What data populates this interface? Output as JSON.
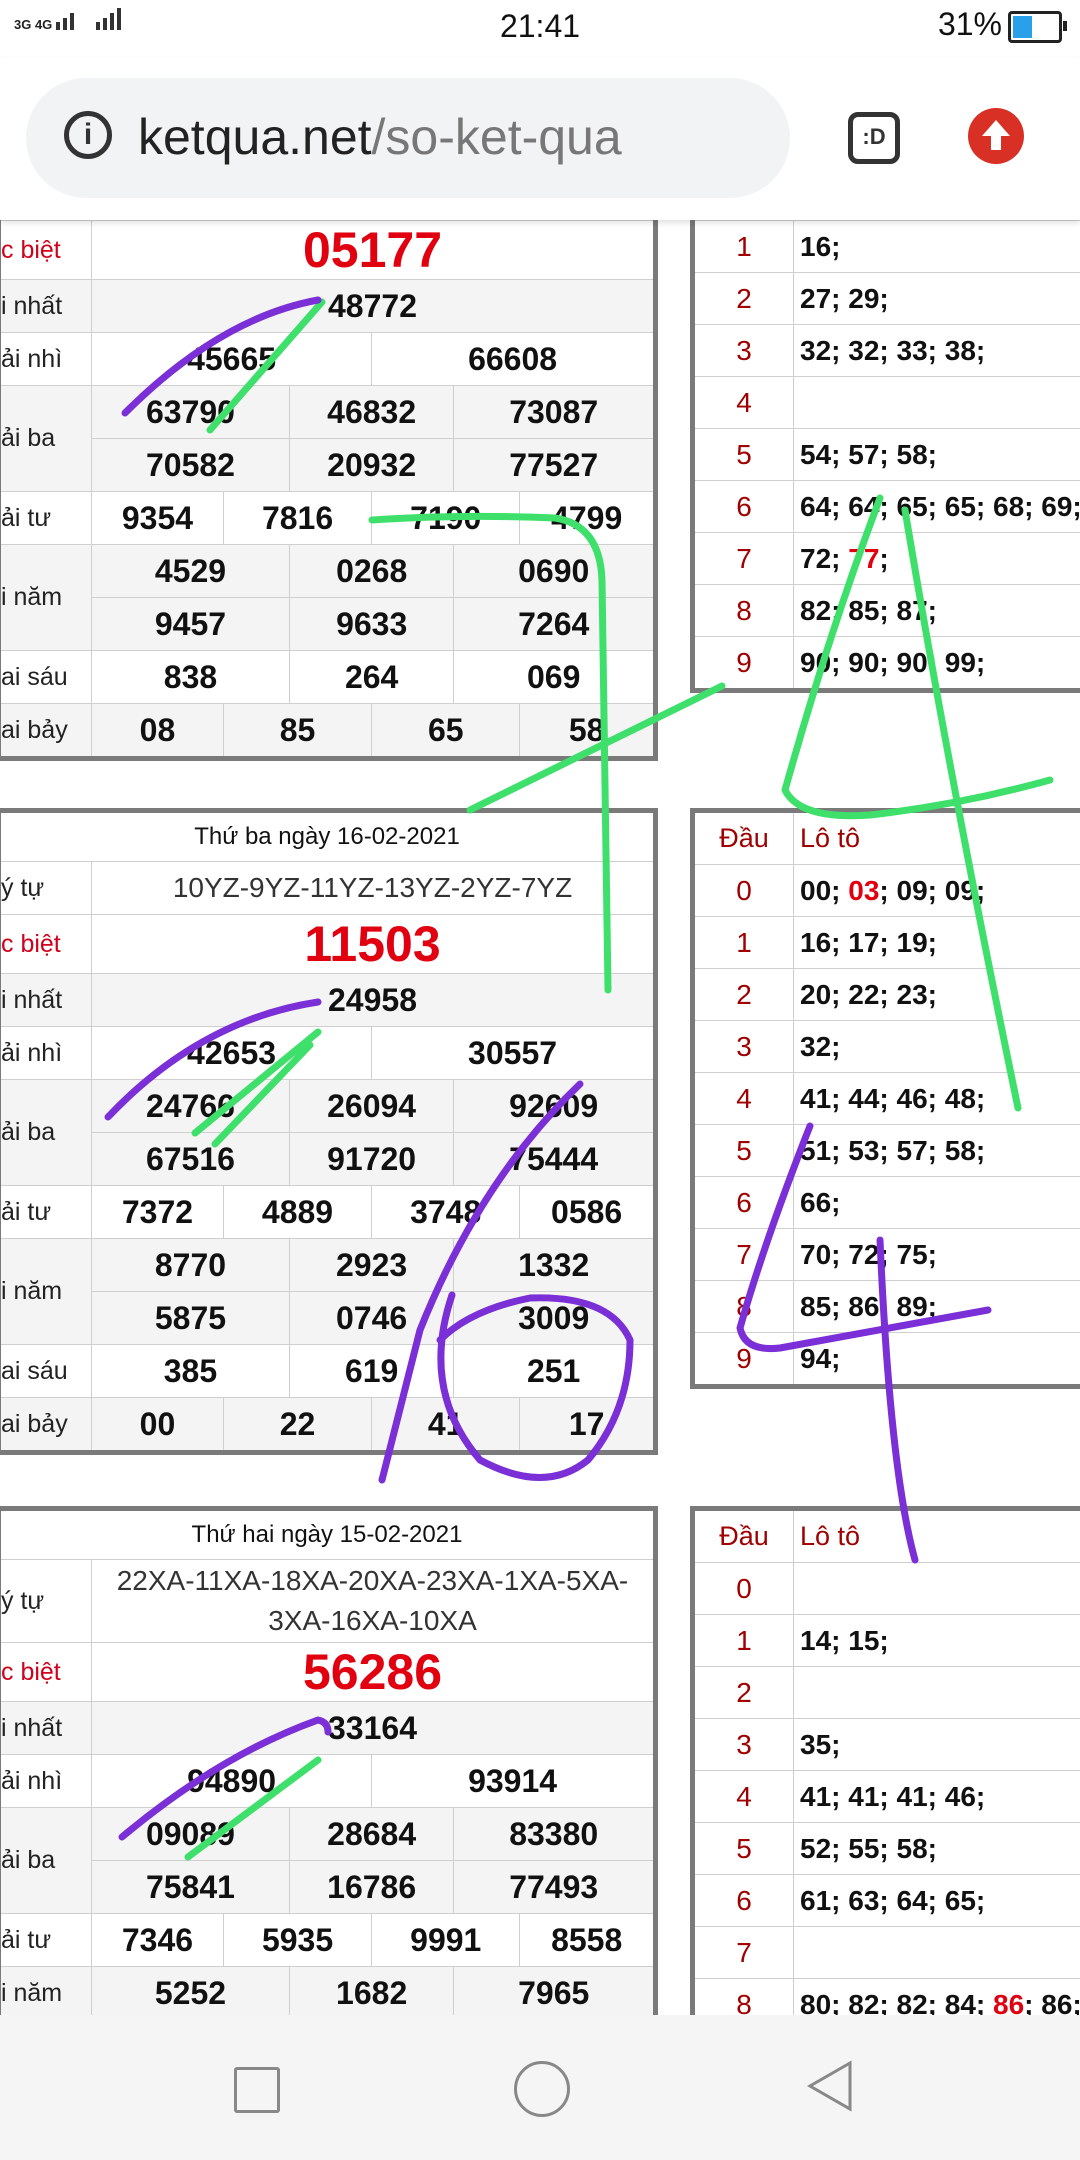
{
  "status": {
    "network": "3G 4G",
    "time": "21:41",
    "battery": "31%"
  },
  "browser": {
    "domain": "ketqua.net",
    "path": "/so-ket-qua",
    "tab_icon": ":D"
  },
  "labels": {
    "db": "c biệt",
    "nhat": "i nhất",
    "nhi": "ải nhì",
    "ba": "ải ba",
    "tu": "ải tư",
    "nam": "i năm",
    "sau": "ai sáu",
    "bay": "ai bảy",
    "kyhieu": "ý tự",
    "dau": "Đầu",
    "loto": "Lô tô"
  },
  "draw1": {
    "db": "05177",
    "g1": "48772",
    "g2": [
      "45665",
      "66608"
    ],
    "g3": [
      "63790",
      "46832",
      "73087",
      "70582",
      "20932",
      "77527"
    ],
    "g4": [
      "9354",
      "7816",
      "7190",
      "4799"
    ],
    "g5": [
      "4529",
      "0268",
      "0690",
      "9457",
      "9633",
      "7264"
    ],
    "g6": [
      "838",
      "264",
      "069"
    ],
    "g7": [
      "08",
      "85",
      "65",
      "58"
    ]
  },
  "loto1": [
    {
      "k": "1",
      "v": "16;"
    },
    {
      "k": "2",
      "v": "27; 29;"
    },
    {
      "k": "3",
      "v": "32; 32; 33; 38;"
    },
    {
      "k": "4",
      "v": ""
    },
    {
      "k": "5",
      "v": "54; 57; 58;"
    },
    {
      "k": "6",
      "v": "64; 64; 65; 65; 68; 69;"
    },
    {
      "k": "7",
      "pre": "72; ",
      "red": "77",
      "post": ";"
    },
    {
      "k": "8",
      "v": "82; 85; 87;"
    },
    {
      "k": "9",
      "v": "90; 90; 90; 99;"
    }
  ],
  "draw2": {
    "date": "Thứ ba ngày 16-02-2021",
    "seq": "10YZ-9YZ-11YZ-13YZ-2YZ-7YZ",
    "db": "11503",
    "g1": "24958",
    "g2": [
      "42653",
      "30557"
    ],
    "g3": [
      "24766",
      "26094",
      "92609",
      "67516",
      "91720",
      "75444"
    ],
    "g4": [
      "7372",
      "4889",
      "3748",
      "0586"
    ],
    "g5": [
      "8770",
      "2923",
      "1332",
      "5875",
      "0746",
      "3009"
    ],
    "g6": [
      "385",
      "619",
      "251"
    ],
    "g7": [
      "00",
      "22",
      "41",
      "17"
    ]
  },
  "loto2": [
    {
      "k": "0",
      "pre": "00; ",
      "red": "03",
      "post": "; 09; 09;"
    },
    {
      "k": "1",
      "v": "16; 17; 19;"
    },
    {
      "k": "2",
      "v": "20; 22; 23;"
    },
    {
      "k": "3",
      "v": "32;"
    },
    {
      "k": "4",
      "v": "41; 44; 46; 48;"
    },
    {
      "k": "5",
      "v": "51; 53; 57; 58;"
    },
    {
      "k": "6",
      "v": "66;"
    },
    {
      "k": "7",
      "v": "70; 72; 75;"
    },
    {
      "k": "8",
      "v": "85; 86; 89;"
    },
    {
      "k": "9",
      "v": "94;"
    }
  ],
  "draw3": {
    "date": "Thứ hai ngày 15-02-2021",
    "seq": "22XA-11XA-18XA-20XA-23XA-1XA-5XA-3XA-16XA-10XA",
    "db": "56286",
    "g1": "33164",
    "g2": [
      "94890",
      "93914"
    ],
    "g3": [
      "09089",
      "28684",
      "83380",
      "75841",
      "16786",
      "77493"
    ],
    "g4": [
      "7346",
      "5935",
      "9991",
      "8558"
    ],
    "g5": [
      "5252",
      "1682",
      "7965"
    ]
  },
  "loto3": [
    {
      "k": "0",
      "v": ""
    },
    {
      "k": "1",
      "v": "14; 15;"
    },
    {
      "k": "2",
      "v": ""
    },
    {
      "k": "3",
      "v": "35;"
    },
    {
      "k": "4",
      "v": "41; 41; 41; 46;"
    },
    {
      "k": "5",
      "v": "52; 55; 58;"
    },
    {
      "k": "6",
      "v": "61; 63; 64; 65;"
    },
    {
      "k": "7",
      "v": ""
    },
    {
      "k": "8",
      "pre": "80; 82; 82; 84; ",
      "red": "86",
      "post": "; 86;"
    }
  ],
  "colors": {
    "special": "#e0000f",
    "scribble_green": "#3ee06b",
    "scribble_purple": "#7b2fd6"
  }
}
